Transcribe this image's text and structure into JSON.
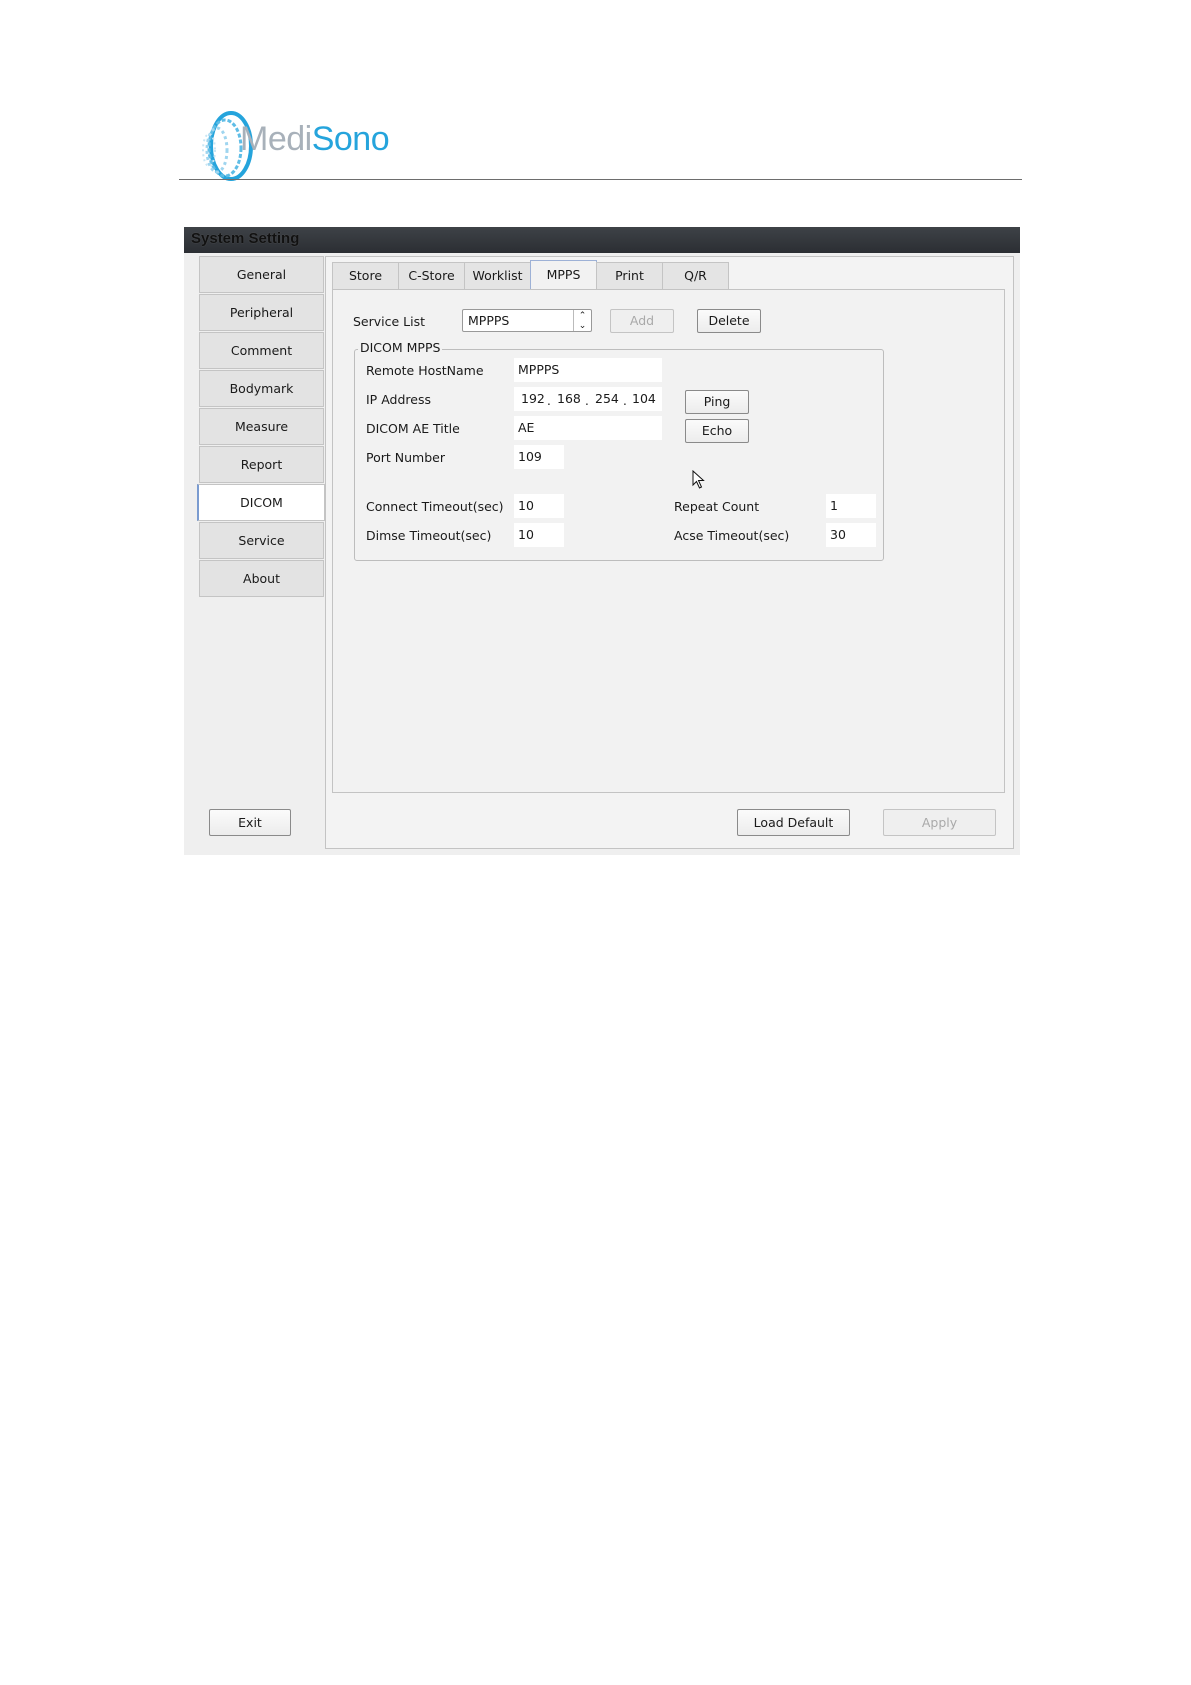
{
  "logo": {
    "part1": "Medi",
    "part2": "Sono"
  },
  "window": {
    "title": "System Setting"
  },
  "nav": {
    "items": [
      {
        "label": "General"
      },
      {
        "label": "Peripheral"
      },
      {
        "label": "Comment"
      },
      {
        "label": "Bodymark"
      },
      {
        "label": "Measure"
      },
      {
        "label": "Report"
      },
      {
        "label": "DICOM"
      },
      {
        "label": "Service"
      },
      {
        "label": "About"
      }
    ],
    "active": "DICOM"
  },
  "tabs": {
    "items": [
      {
        "label": "Store"
      },
      {
        "label": "C-Store"
      },
      {
        "label": "Worklist"
      },
      {
        "label": "MPPS"
      },
      {
        "label": "Print"
      },
      {
        "label": "Q/R"
      }
    ],
    "active": "MPPS"
  },
  "service_list": {
    "label": "Service List",
    "value": "MPPPS",
    "add_label": "Add",
    "delete_label": "Delete"
  },
  "dicom_mpps": {
    "group_title": "DICOM MPPS",
    "remote_hostname": {
      "label": "Remote HostName",
      "value": "MPPPS"
    },
    "ip_address": {
      "label": "IP Address",
      "octets": [
        "192",
        "168",
        "254",
        "104"
      ]
    },
    "ae_title": {
      "label": "DICOM AE Title",
      "value": "AE"
    },
    "port_number": {
      "label": "Port Number",
      "value": "109"
    },
    "ping_label": "Ping",
    "echo_label": "Echo",
    "connect_timeout": {
      "label": "Connect Timeout(sec)",
      "value": "10"
    },
    "dimse_timeout": {
      "label": "Dimse Timeout(sec)",
      "value": "10"
    },
    "repeat_count": {
      "label": "Repeat Count",
      "value": "1"
    },
    "acse_timeout": {
      "label": "Acse Timeout(sec)",
      "value": "30"
    }
  },
  "footer": {
    "exit_label": "Exit",
    "load_default_label": "Load Default",
    "apply_label": "Apply"
  },
  "colors": {
    "titlebar": "#2f3237",
    "logo_blue": "#25a4dc",
    "logo_grey": "#a8b1ba",
    "active_accent": "#7a9bd0"
  }
}
